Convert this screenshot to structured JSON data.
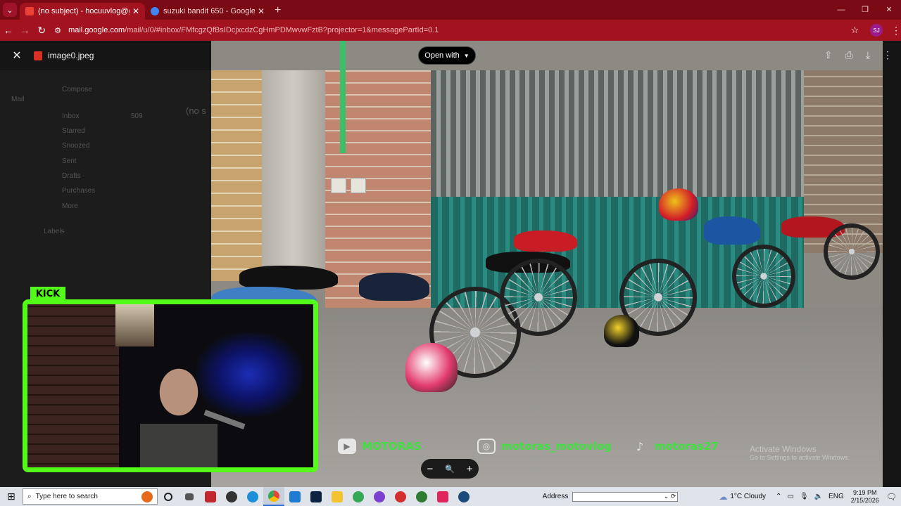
{
  "browser": {
    "tabs": [
      {
        "label": "(no subject) - hocuuvlog@gm...",
        "active": true,
        "favicon_color": "#ea4335"
      },
      {
        "label": "suzuki bandit 650 - Google Sea",
        "active": false,
        "favicon_color": "#4285f4"
      }
    ],
    "new_tab": "+",
    "url_host": "mail.google.com",
    "url_path": "/mail/u/0/#inbox/FMfcgzQfBsIDcjxcdzCgHmPDMwvwFztB?projector=1&messagePartId=0.1",
    "profile_initials": "SJ",
    "accent": "#a3121f"
  },
  "viewer": {
    "file_name": "image0.jpeg",
    "open_with": "Open with",
    "zoom_minus": "−",
    "zoom_icon": "🔍",
    "zoom_plus": "+"
  },
  "gmail_bg": {
    "compose": "Compose",
    "inbox": "Inbox",
    "inbox_count": "509",
    "starred": "Starred",
    "snoozed": "Snoozed",
    "sent": "Sent",
    "drafts": "Drafts",
    "purchases": "Purchases",
    "more": "More",
    "labels": "Labels",
    "subject_partial": "(no s",
    "mail": "Mail"
  },
  "stream": {
    "kick_label": "KICK",
    "socials": [
      {
        "icon": "youtube-icon",
        "text": "MOTORAS"
      },
      {
        "icon": "instagram-icon",
        "text": "motoras_motovlog"
      },
      {
        "icon": "tiktok-icon",
        "text": "motoras27"
      }
    ],
    "watermark_title": "Activate Windows",
    "watermark_sub": "Go to Settings to activate Windows."
  },
  "taskbar": {
    "search_placeholder": "Type here to search",
    "address_label": "Address",
    "weather": "1°C  Cloudy",
    "language": "ENG",
    "time": "9:19 PM",
    "date": "2/15/2026"
  }
}
